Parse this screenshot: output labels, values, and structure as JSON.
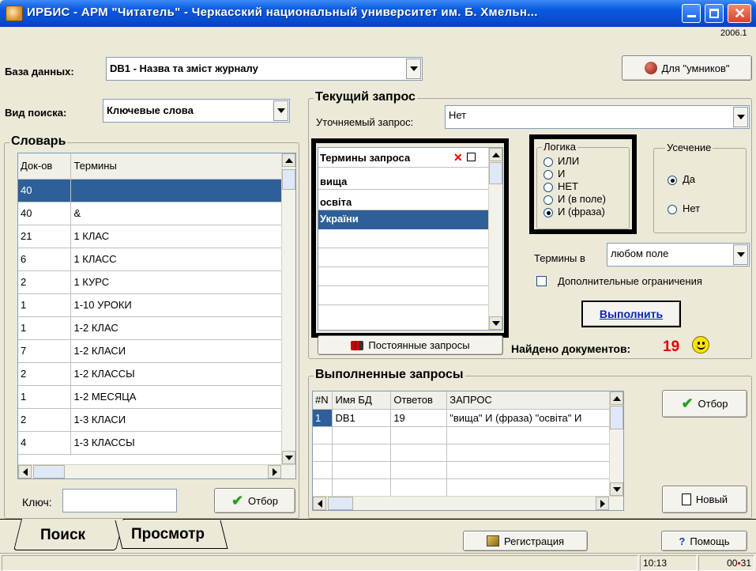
{
  "window": {
    "title": "ИРБИС - АРМ \"Читатель\" - Черкасский национальный университет им. Б. Хмельн...",
    "version": "2006.1"
  },
  "database": {
    "label": "База данных:",
    "value": "DB1 - Назва та зміст журналу"
  },
  "experts_button": "Для \"умников\"",
  "search_type": {
    "label": "Вид поиска:",
    "value": "Ключевые слова"
  },
  "dictionary": {
    "title": "Словарь",
    "columns": [
      "Док-ов",
      "Термины"
    ],
    "rows": [
      [
        "40",
        ""
      ],
      [
        "40",
        "&"
      ],
      [
        "21",
        "1 КЛАС"
      ],
      [
        "6",
        "1 КЛАСС"
      ],
      [
        "2",
        "1 КУРС"
      ],
      [
        "1",
        "1-10 УРОКИ"
      ],
      [
        "1",
        "1-2 КЛАС"
      ],
      [
        "7",
        "1-2 КЛАСИ"
      ],
      [
        "2",
        "1-2 КЛАССЫ"
      ],
      [
        "1",
        "1-2 МЕСЯЦА"
      ],
      [
        "2",
        "1-3 КЛАСИ"
      ],
      [
        "4",
        "1-3 КЛАССЫ"
      ]
    ],
    "key_label": "Ключ:",
    "key_value": "",
    "select_button": "Отбор"
  },
  "current_query": {
    "title": "Текущий запрос",
    "refine_label": "Уточняемый запрос:",
    "refine_value": "Нет",
    "terms_header": "Термины запроса",
    "terms": [
      "вища",
      "освіта",
      "України",
      "",
      "",
      "",
      ""
    ],
    "logic": {
      "title": "Логика",
      "options": [
        "ИЛИ",
        "И",
        "НЕТ",
        "И (в поле)",
        "И (фраза)"
      ],
      "selected": "И (фраза)"
    },
    "truncation": {
      "title": "Усечение",
      "options": [
        "Да",
        "Нет"
      ],
      "selected": "Да"
    },
    "terms_in_label": "Термины в",
    "terms_in_value": "любом поле",
    "extra_limits": "Дополнительные ограничения",
    "execute_button": "Выполнить",
    "permanent_button": "Постоянные запросы",
    "found_label": "Найдено документов:",
    "found_count": "19"
  },
  "executed": {
    "title": "Выполненные запросы",
    "columns": [
      "#N",
      "Имя БД",
      "Ответов",
      "ЗАПРОС"
    ],
    "rows": [
      [
        "1",
        "DB1",
        "19",
        "\"вища\" И (фраза) \"освіта\" И"
      ]
    ],
    "select_button": "Отбор",
    "new_button": "Новый"
  },
  "tabs": [
    "Поиск",
    "Просмотр"
  ],
  "register_button": "Регистрация",
  "help_button": "Помощь",
  "status": {
    "time": "10:13",
    "timer_a": "00",
    "timer_b": "31"
  },
  "colors": {
    "selection": "#2e5f98",
    "found_count": "#e00000",
    "smiley": "#ffe400"
  }
}
